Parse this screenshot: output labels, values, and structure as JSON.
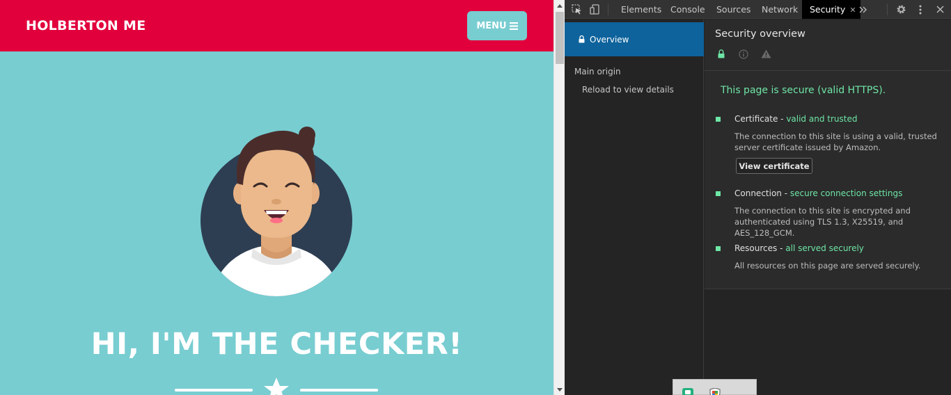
{
  "webpage": {
    "brand": "HOLBERTON ME",
    "menu_label": "MENU",
    "hero_heading": "HI, I'M THE CHECKER!",
    "colors": {
      "navbar": "#e1003c",
      "background": "#78cdd1",
      "avatar_circle": "#2e3e52"
    }
  },
  "devtools": {
    "tabs": [
      {
        "label": "Elements"
      },
      {
        "label": "Console"
      },
      {
        "label": "Sources"
      },
      {
        "label": "Network"
      },
      {
        "label": "Security",
        "active": true
      }
    ],
    "toolbar_icons": [
      "inspect-element-icon",
      "device-toolbar-icon",
      "more-tabs-icon",
      "settings-gear-icon",
      "kebab-menu-icon",
      "close-icon"
    ],
    "sidebar": {
      "overview_label": "Overview",
      "main_origin_label": "Main origin",
      "reload_label": "Reload to view details"
    },
    "security": {
      "title": "Security overview",
      "summary": "This page is secure (valid HTTPS).",
      "items": [
        {
          "name": "Certificate",
          "status": "valid and trusted",
          "description": "The connection to this site is using a valid, trusted server certificate issued by Amazon.",
          "button": "View certificate"
        },
        {
          "name": "Connection",
          "status": "secure connection settings",
          "description": "The connection to this site is encrypted and authenticated using TLS 1.3, X25519, and AES_128_GCM."
        },
        {
          "name": "Resources",
          "status": "all served securely",
          "description": "All resources on this page are served securely."
        }
      ],
      "accent_green": "#6ee6a6",
      "selected_blue": "#0e639c"
    }
  }
}
